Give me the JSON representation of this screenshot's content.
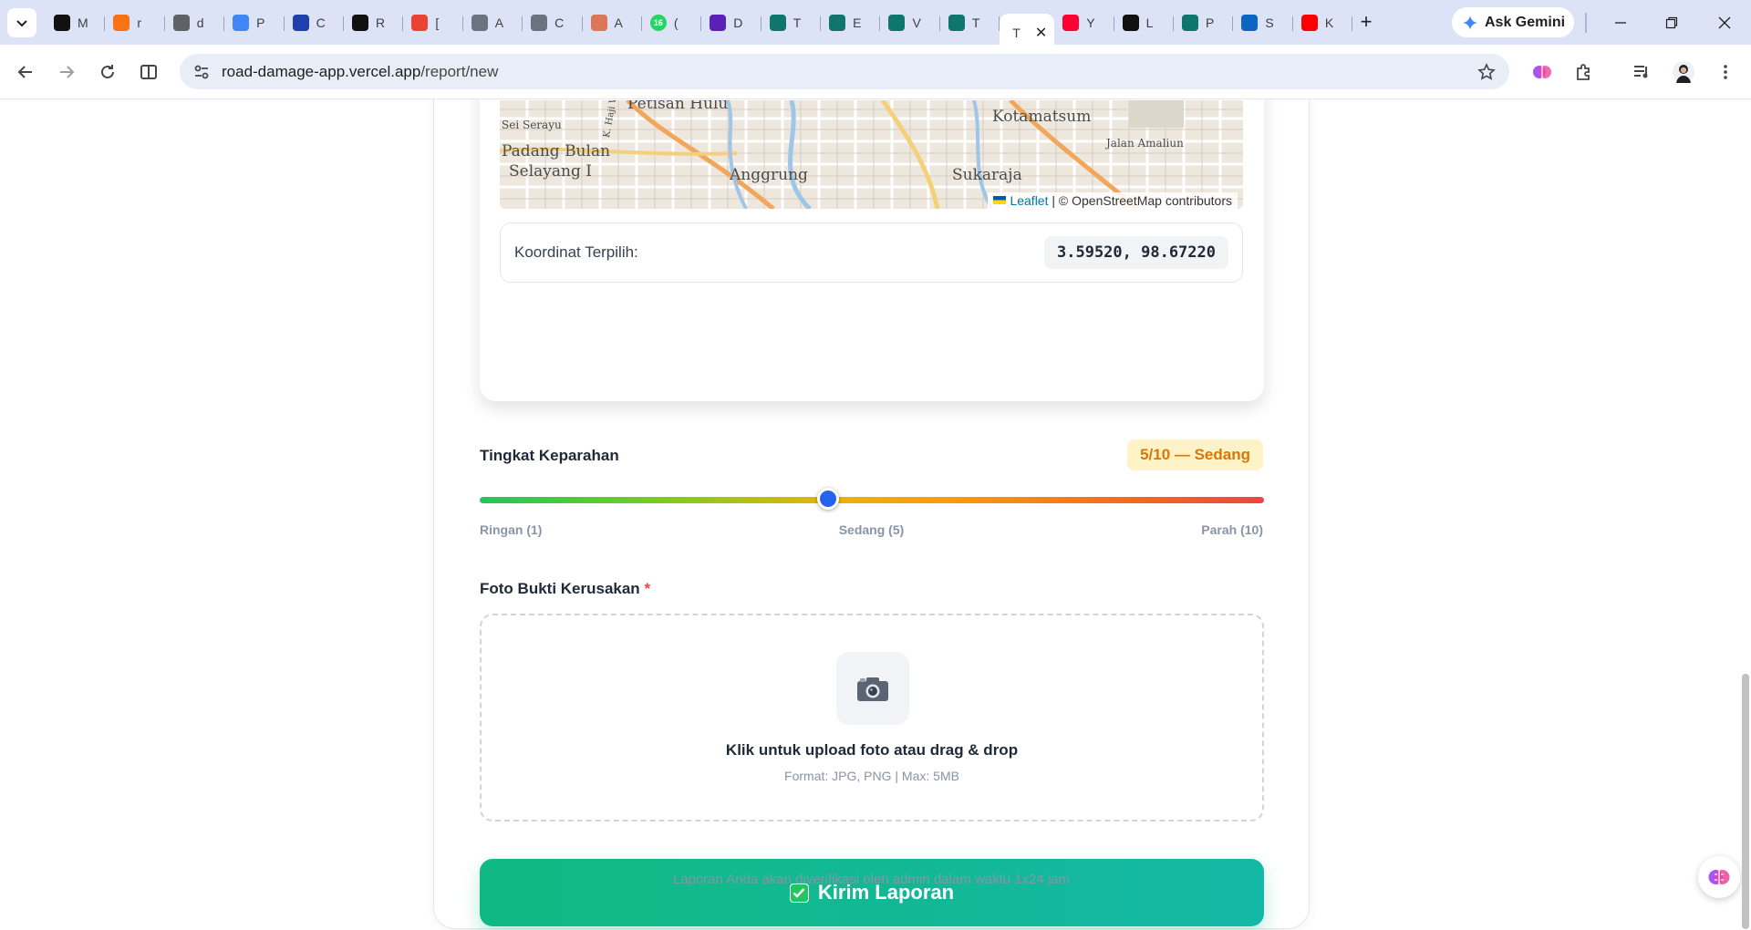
{
  "browser": {
    "tabs": [
      {
        "title": "M",
        "icon": "openai-icon",
        "color": "#111111"
      },
      {
        "title": "r",
        "icon": "flame-icon",
        "color": "#f97316"
      },
      {
        "title": "d",
        "icon": "globe-icon",
        "color": "#5f6368"
      },
      {
        "title": "P",
        "icon": "gemini-star-icon",
        "color": "#4285f4"
      },
      {
        "title": "C",
        "icon": "cloud-icon",
        "color": "#1e40af"
      },
      {
        "title": "R",
        "icon": "k-logo-icon",
        "color": "#111111"
      },
      {
        "title": "[",
        "icon": "gmail-icon",
        "color": "#ea4335"
      },
      {
        "title": "A",
        "icon": "gear-logo-icon",
        "color": "#6b7280"
      },
      {
        "title": "C",
        "icon": "gear-logo-icon",
        "color": "#6b7280"
      },
      {
        "title": "A",
        "icon": "claude-icon",
        "color": "#d97757"
      },
      {
        "title": "(",
        "icon": "whatsapp-icon",
        "color": "#25d366",
        "badge": "16"
      },
      {
        "title": "D",
        "icon": "hexagon-icon",
        "color": "#5b21b6"
      },
      {
        "title": "T",
        "icon": "university-icon",
        "color": "#0f766e"
      },
      {
        "title": "E",
        "icon": "university-icon",
        "color": "#0f766e"
      },
      {
        "title": "V",
        "icon": "university-icon",
        "color": "#0f766e"
      },
      {
        "title": "T",
        "icon": "university-icon",
        "color": "#0f766e"
      },
      {
        "title": "T",
        "icon": "",
        "color": "#ffffff",
        "active": true
      },
      {
        "title": "Y",
        "icon": "youtube-music-icon",
        "color": "#ff0033"
      },
      {
        "title": "L",
        "icon": "bolt-icon",
        "color": "#111111"
      },
      {
        "title": "P",
        "icon": "university-icon",
        "color": "#0f766e"
      },
      {
        "title": "S",
        "icon": "linkedin-icon",
        "color": "#0a66c2"
      },
      {
        "title": "K",
        "icon": "youtube-icon",
        "color": "#ff0000"
      }
    ],
    "new_tab": "+",
    "gemini_label": "Ask Gemini",
    "url_host": "road-damage-app.vercel.app",
    "url_path": "/report/new"
  },
  "map": {
    "labels": [
      "Petisan Hulu",
      "Sei Serayu",
      "Padang Bulan",
      "Selayang I",
      "Anggrung",
      "Kotamatsum",
      "Sukaraja",
      "Jalan Amaliun",
      "K. Haji Wahid"
    ],
    "attribution_leaflet": "Leaflet",
    "attribution_osm": "| © OpenStreetMap contributors"
  },
  "coordinates": {
    "label": "Koordinat Terpilih:",
    "value": "3.59520, 98.67220"
  },
  "severity": {
    "title": "Tingkat Keparahan",
    "badge": "5/10 — Sedang",
    "value": 5,
    "min": 1,
    "max": 10,
    "tick_low": "Ringan (1)",
    "tick_mid": "Sedang (5)",
    "tick_high": "Parah (10)"
  },
  "photo": {
    "title": "Foto Bukti Kerusakan",
    "required_mark": "*",
    "icon": "camera-icon",
    "main_text": "Klik untuk upload foto atau drag & drop",
    "sub_text": "Format: JPG, PNG | Max: 5MB"
  },
  "submit": {
    "label": "Kirim Laporan",
    "icon": "check-box-icon"
  },
  "footnote": "Laporan Anda akan diverifikasi oleh admin dalam waktu 1x24 jam",
  "colors": {
    "accent_green": "#10b981",
    "slider_thumb": "#2563eb",
    "badge_text": "#d97706",
    "badge_bg": "#fef3c7"
  }
}
